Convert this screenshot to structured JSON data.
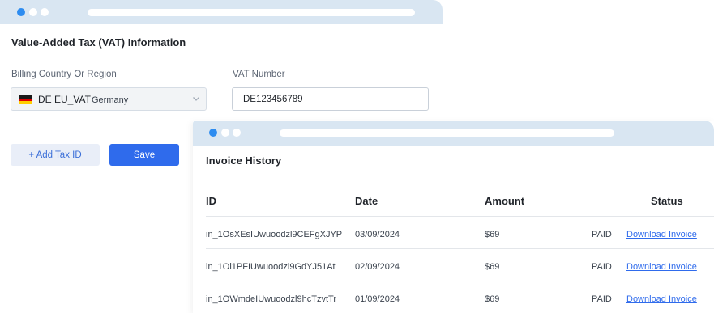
{
  "vat": {
    "title": "Value-Added Tax (VAT) Information",
    "country_label": "Billing Country Or Region",
    "country_code": "DE EU_VAT",
    "country_name": "Germany",
    "flag_icon": "germany-flag-icon",
    "vat_label": "VAT Number",
    "vat_value": "DE123456789",
    "add_tax_label": "+ Add Tax ID",
    "save_label": "Save"
  },
  "invoice": {
    "title": "Invoice History",
    "columns": {
      "id": "ID",
      "date": "Date",
      "amount": "Amount",
      "status": "Status"
    },
    "rows": [
      {
        "id": "in_1OsXEsIUwuoodzl9CEFgXJYP",
        "date": "03/09/2024",
        "amount": "$69",
        "status": "PAID",
        "action": "Download Invoice"
      },
      {
        "id": "in_1Oi1PFIUwuoodzl9GdYJ51At",
        "date": "02/09/2024",
        "amount": "$69",
        "status": "PAID",
        "action": "Download Invoice"
      },
      {
        "id": "in_1OWmdeIUwuoodzl9hcTzvtTr",
        "date": "01/09/2024",
        "amount": "$69",
        "status": "PAID",
        "action": "Download Invoice"
      }
    ]
  },
  "colors": {
    "accent": "#2f6bec",
    "chrome": "#d9e6f2",
    "dot_active": "#2d8cf0"
  }
}
